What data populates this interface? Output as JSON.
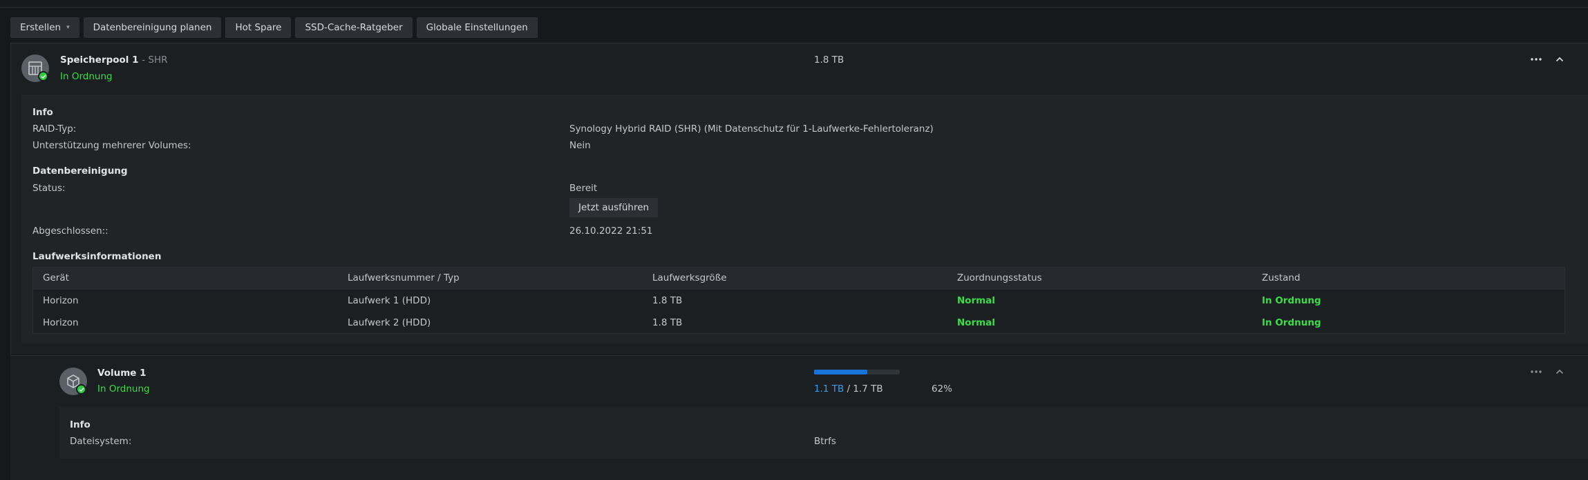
{
  "toolbar": {
    "create": "Erstellen",
    "schedule_scrub": "Datenbereinigung planen",
    "hot_spare": "Hot Spare",
    "ssd_cache": "SSD-Cache-Ratgeber",
    "global_settings": "Globale Einstellungen"
  },
  "pool": {
    "name": "Speicherpool 1",
    "type_suffix": "- SHR",
    "status": "In Ordnung",
    "size": "1.8 TB",
    "info_heading": "Info",
    "raid_label": "RAID-Typ:",
    "raid_value": "Synology Hybrid RAID (SHR) (Mit Datenschutz für 1-Laufwerke-Fehlertoleranz)",
    "multi_label": "Unterstützung mehrerer Volumes:",
    "multi_value": "Nein",
    "scrub_heading": "Datenbereinigung",
    "status_label": "Status:",
    "status_value": "Bereit",
    "run_now": "Jetzt ausführen",
    "completed_label": "Abgeschlossen::",
    "completed_value": "26.10.2022 21:51",
    "drives_heading": "Laufwerksinformationen",
    "columns": [
      "Gerät",
      "Laufwerksnummer / Typ",
      "Laufwerksgröße",
      "Zuordnungsstatus",
      "Zustand"
    ],
    "drives": [
      {
        "device": "Horizon",
        "drive": "Laufwerk 1 (HDD)",
        "size": "1.8 TB",
        "allocation": "Normal",
        "health": "In Ordnung"
      },
      {
        "device": "Horizon",
        "drive": "Laufwerk 2 (HDD)",
        "size": "1.8 TB",
        "allocation": "Normal",
        "health": "In Ordnung"
      }
    ]
  },
  "volume": {
    "name": "Volume 1",
    "status": "In Ordnung",
    "used": "1.1 TB",
    "separator": " / ",
    "total": "1.7 TB",
    "percent": "62%",
    "usage_fraction": 0.62,
    "info_heading": "Info",
    "fs_label": "Dateisystem:",
    "fs_value": "Btrfs"
  },
  "colors": {
    "ok_green": "#3ddc4b",
    "progress_blue": "#1a73d9",
    "used_blue": "#3d9be9"
  },
  "icons": {
    "pool": "storage-pool-icon",
    "volume": "volume-cube-icon",
    "more": "more-horizontal-icon",
    "collapse": "chevron-up-icon",
    "ok_badge": "check-badge-icon"
  }
}
